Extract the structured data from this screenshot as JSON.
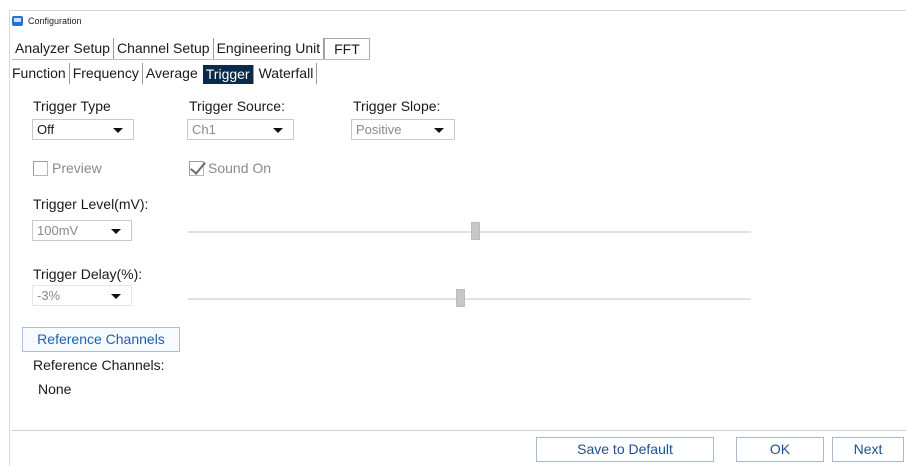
{
  "window": {
    "title": "Configuration"
  },
  "main_tabs": [
    {
      "label": "Analyzer Setup"
    },
    {
      "label": "Channel Setup"
    },
    {
      "label": "Engineering Unit"
    },
    {
      "label": "FFT"
    }
  ],
  "sub_tabs": [
    {
      "label": "Function"
    },
    {
      "label": "Frequency"
    },
    {
      "label": "Average"
    },
    {
      "label": "Trigger",
      "active": true
    },
    {
      "label": "Waterfall"
    }
  ],
  "trigger": {
    "type_label": "Trigger Type",
    "type_value": "Off",
    "source_label": "Trigger Source:",
    "source_value": "Ch1",
    "slope_label": "Trigger Slope:",
    "slope_value": "Positive",
    "preview_label": "Preview",
    "preview_checked": false,
    "sound_label": "Sound On",
    "sound_checked": true,
    "level_label": "Trigger Level(mV):",
    "level_value": "100mV",
    "delay_label": "Trigger Delay(%):",
    "delay_value": "-3%"
  },
  "reference": {
    "button_label": "Reference Channels",
    "caption": "Reference Channels:",
    "value": "None"
  },
  "footer": {
    "save_default": "Save to Default",
    "ok": "OK",
    "next": "Next"
  },
  "icons": {
    "app": "configuration-app-icon",
    "dropdown": "chevron-down-icon",
    "check": "checkmark-icon"
  }
}
